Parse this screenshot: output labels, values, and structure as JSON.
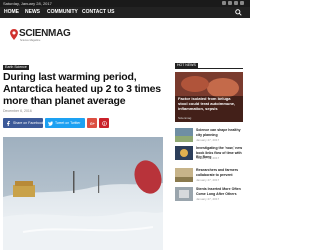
{
  "topbar": {
    "date": "Saturday, January 28, 2017"
  },
  "navbar": {
    "items": [
      "HOME",
      "NEWS",
      "COMMUNITY",
      "CONTACT US"
    ]
  },
  "brand": {
    "name": "SCIENMAG",
    "tagline": "Science Magazine"
  },
  "article": {
    "category": "Earth Science",
    "title": "During last warming period, Antarctica heated up 2 to 3 times more than planet average",
    "date": "December 6, 2016",
    "share_facebook": "Share on Facebook",
    "share_twitter": "Tweet on Twitter"
  },
  "sidebar": {
    "label": "HOT NEWS",
    "featured": {
      "title": "Factor isolated from beluga stool could treat autoimmune, inflammation, sepsis",
      "meta": "Scienmag"
    },
    "items": [
      {
        "title": "Science can shape healthy city planning",
        "date": "January 27, 2017"
      },
      {
        "title": "Investigating the 'now,' new book links flow of time with Big Bang",
        "date": "January 27, 2017"
      },
      {
        "title": "Researchers and farmers collaborate to prevent",
        "date": "January 27, 2017"
      },
      {
        "title": "Stents Inserted More Often Come Long After Others",
        "date": "January 27, 2017"
      }
    ]
  },
  "colors": {
    "facebook": "#3b5998",
    "twitter": "#1da1f2",
    "googleplus": "#dc4e41",
    "pinterest": "#ca212a",
    "brand_red": "#d0312d"
  }
}
